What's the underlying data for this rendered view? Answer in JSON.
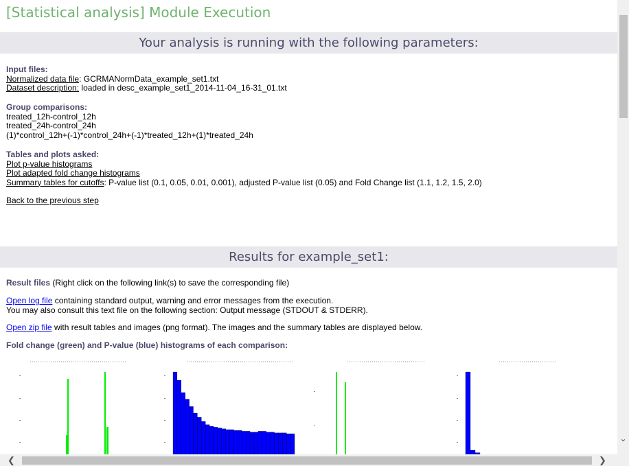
{
  "page": {
    "title": "[Statistical analysis] Module Execution"
  },
  "params": {
    "heading": "Your analysis is running with the following parameters:",
    "input_files_label": "Input files:",
    "normalized_label": "Normalized data file",
    "normalized_value": ": GCRMANormData_example_set1.txt",
    "dataset_label": "Dataset description:",
    "dataset_value": " loaded in desc_example_set1_2014-11-04_16-31_01.txt",
    "group_label": "Group comparisons:",
    "groups": [
      "treated_12h-control_12h",
      "treated_24h-control_24h",
      "(1)*control_12h+(-1)*control_24h+(-1)*treated_12h+(1)*treated_24h"
    ],
    "tables_label": "Tables and plots asked:",
    "plot_pvalue": "Plot p-value histograms",
    "plot_fold": "Plot adapted fold change histograms",
    "summary_label": "Summary tables for cutoffs",
    "summary_value": ": P-value list (0.1, 0.05, 0.01, 0.001), adjusted P-value list (0.05) and Fold Change list (1.1, 1.2, 1.5, 2.0)",
    "back_link": "Back to the previous step"
  },
  "results": {
    "heading": "Results for example_set1:",
    "files_label": "Result files",
    "files_note": " (Right click on the following link(s) to save the corresponding file)",
    "log_link": "Open log file",
    "log_text": " containing standard output, warning and error messages from the execution.",
    "log_text2": "You may also consult this text file on the following section: Output message (STDOUT & STDERR).",
    "zip_link": "Open zip file",
    "zip_text": " with result tables and images (png format). The images and the summary tables are displayed below.",
    "hist_label": "Fold change (green) and P-value (blue) histograms of each comparison:"
  },
  "colors": {
    "fold_change": "#00ee00",
    "p_value": "#0000ff"
  },
  "plots": {
    "fold_change_1": [
      0,
      0,
      0,
      0,
      0,
      0,
      0,
      0,
      0,
      0,
      0,
      0,
      0,
      0,
      0,
      0,
      0,
      0,
      0,
      0,
      0,
      0,
      0,
      0,
      0,
      0,
      0,
      0,
      0,
      0,
      0,
      0,
      0,
      0,
      0,
      0,
      0,
      0,
      0,
      0,
      0,
      0,
      0,
      0,
      0,
      0,
      0,
      0,
      0,
      0,
      0,
      0,
      0,
      0,
      0,
      0,
      0,
      0,
      0,
      0,
      0,
      0,
      0,
      0,
      0,
      0,
      0,
      0,
      0,
      0,
      0,
      0,
      0,
      0,
      0,
      0,
      0,
      0,
      0,
      0,
      0,
      0,
      0,
      0,
      0,
      0,
      0,
      0
    ],
    "pvalue_hist_1": [
      100,
      90,
      75,
      67,
      58,
      50,
      45,
      40,
      36,
      34,
      33,
      32,
      31,
      30,
      30,
      29,
      29,
      28,
      28,
      27,
      27,
      28,
      28,
      27,
      27,
      26,
      26,
      26,
      25,
      25
    ],
    "pvalue_hist_2": [
      100,
      5,
      2,
      0,
      0,
      0,
      0,
      0,
      0,
      0,
      0,
      0,
      0,
      0,
      0,
      0,
      0,
      0,
      0,
      0,
      0,
      0,
      0,
      0,
      0,
      0,
      0,
      0,
      0,
      0
    ]
  }
}
